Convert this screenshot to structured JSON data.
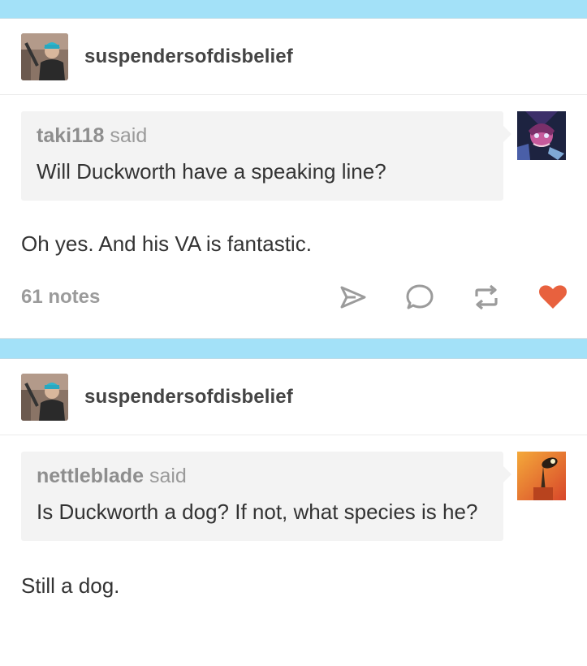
{
  "posts": [
    {
      "blog_name": "suspendersofdisbelief",
      "asker": "taki118",
      "said": "said",
      "question": "Will Duckworth have a speaking line?",
      "answer": "Oh yes. And his VA is fantastic.",
      "notes": "61 notes"
    },
    {
      "blog_name": "suspendersofdisbelief",
      "asker": "nettleblade",
      "said": "said",
      "question": "Is Duckworth a dog? If not, what species is he?",
      "answer": "Still a dog.",
      "notes": ""
    }
  ],
  "icons": {
    "share": "paper-plane-icon",
    "reply": "speech-bubble-icon",
    "reblog": "reblog-arrows-icon",
    "like": "heart-icon"
  },
  "colors": {
    "separator": "#a3e1f8",
    "like_active": "#e8613e",
    "action_gray": "#9b9b9b"
  }
}
